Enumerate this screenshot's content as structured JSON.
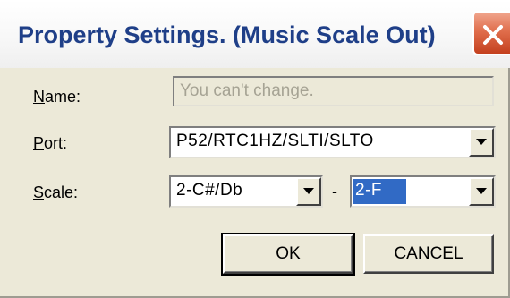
{
  "window": {
    "title": "Property Settings. (Music Scale Out)"
  },
  "form": {
    "name_label_prefix": "N",
    "name_label_rest": "ame:",
    "name_placeholder": "You can't change.",
    "port_label_prefix": "P",
    "port_label_rest": "ort:",
    "port_value": "P52/RTC1HZ/SLTI/SLTO",
    "scale_label_prefix": "S",
    "scale_label_rest": "cale:",
    "scale_from_value": "2-C#/Db",
    "scale_separator": "-",
    "scale_to_value": "2-F"
  },
  "buttons": {
    "ok_label": "OK",
    "cancel_label": "CANCEL"
  }
}
